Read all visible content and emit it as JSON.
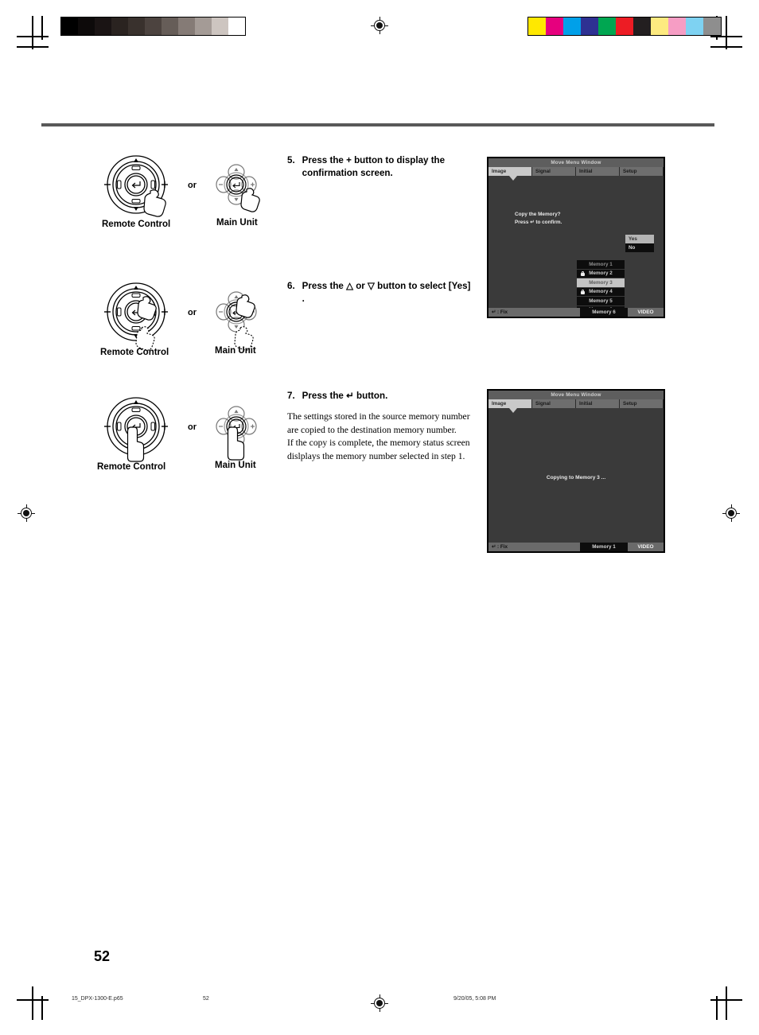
{
  "document": {
    "page_number": "52",
    "footer": {
      "filename": "15_DPX-1300-E.p65",
      "page": "52",
      "timestamp": "9/20/05, 5:08 PM"
    }
  },
  "print_marks": {
    "gray_wedge": [
      "#000000",
      "#0d0a0a",
      "#1a1414",
      "#2a2320",
      "#39312d",
      "#4c433f",
      "#665d58",
      "#857b76",
      "#a49b96",
      "#cdc5c0",
      "#ffffff"
    ],
    "color_bars": [
      "#ffe800",
      "#e6007e",
      "#00a0e9",
      "#2e3192",
      "#00a651",
      "#ed1c24",
      "#231f20",
      "#fdea80",
      "#f69dc4",
      "#7ed2f2",
      "#8e8e8e"
    ]
  },
  "steps": [
    {
      "number": "5.",
      "heading": "Press the + button to display the confirmation screen.",
      "body": "",
      "illustration": {
        "remote_label": "Remote Control",
        "main_label": "Main Unit",
        "or_label": "or"
      }
    },
    {
      "number": "6.",
      "heading": "Press the △ or ▽ button to select [Yes] .",
      "body": "",
      "illustration": {
        "remote_label": "Remote Control",
        "main_label": "Main Unit",
        "or_label": "or"
      }
    },
    {
      "number": "7.",
      "heading": "Press the ↵ button.",
      "body": "The settings stored in the source memory number are copied to the destination memory number.\nIf the copy is complete, the memory status screen dislplays the memory number selected in step 1.",
      "illustration": {
        "remote_label": "Remote Control",
        "main_label": "Main Unit",
        "or_label": "or"
      }
    }
  ],
  "osd_confirm": {
    "title": "Move Menu Window",
    "tabs": [
      {
        "label": "Image",
        "active": true
      },
      {
        "label": "Signal",
        "active": false
      },
      {
        "label": "Initial",
        "active": false
      },
      {
        "label": "Setup",
        "active": false
      }
    ],
    "message": "Copy the Memory?\nPress ↵ to confirm.",
    "options": [
      {
        "label": "Yes",
        "selected": true
      },
      {
        "label": "No",
        "selected": false
      }
    ],
    "memories": [
      {
        "label": "Memory 1",
        "locked": false,
        "selected": false,
        "dim": true
      },
      {
        "label": "Memory 2",
        "locked": true,
        "selected": false,
        "dim": false
      },
      {
        "label": "Memory 3",
        "locked": false,
        "selected": true,
        "dim": false
      },
      {
        "label": "Memory 4",
        "locked": true,
        "selected": false,
        "dim": false
      },
      {
        "label": "Memory 5",
        "locked": false,
        "selected": false,
        "dim": false
      },
      {
        "label": "Memory 6",
        "locked": false,
        "selected": false,
        "dim": false
      }
    ],
    "status_left": "↵ : Fix",
    "status_source": "VIDEO"
  },
  "osd_copying": {
    "title": "Move Menu Window",
    "tabs": [
      {
        "label": "Image",
        "active": true
      },
      {
        "label": "Signal",
        "active": false
      },
      {
        "label": "Initial",
        "active": false
      },
      {
        "label": "Setup",
        "active": false
      }
    ],
    "message": "Copying to Memory 3 ...",
    "status_left": "↵ : Fix",
    "status_memory": "Memory 1",
    "status_source": "VIDEO"
  }
}
